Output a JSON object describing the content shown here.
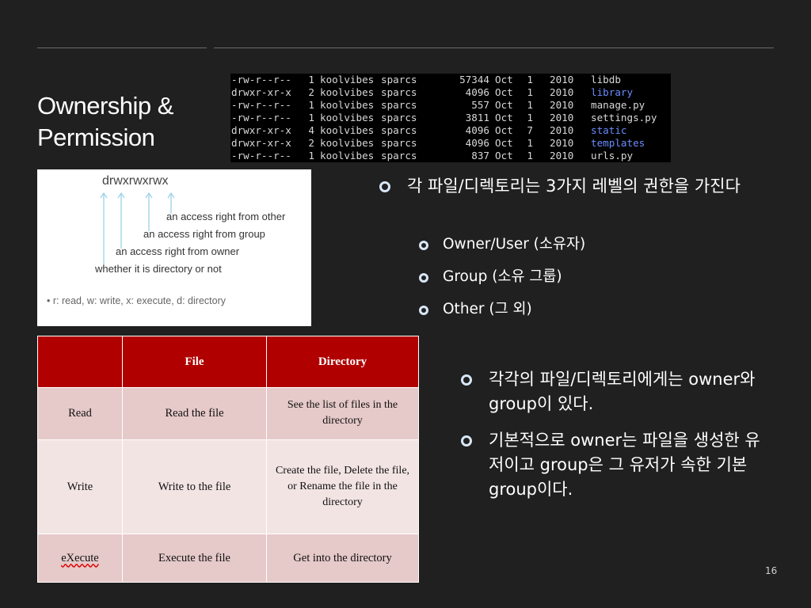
{
  "title": {
    "line1": "Ownership &",
    "line2": "Permission"
  },
  "terminal": {
    "rows": [
      {
        "perm": "-rw-r--r--",
        "links": "1",
        "owner": "koolvibes",
        "group": "sparcs",
        "size": "57344",
        "month": "Oct",
        "day": "1",
        "year": "2010",
        "name": "libdb",
        "is_dir": false
      },
      {
        "perm": "drwxr-xr-x",
        "links": "2",
        "owner": "koolvibes",
        "group": "sparcs",
        "size": "4096",
        "month": "Oct",
        "day": "1",
        "year": "2010",
        "name": "library",
        "is_dir": true
      },
      {
        "perm": "-rw-r--r--",
        "links": "1",
        "owner": "koolvibes",
        "group": "sparcs",
        "size": "557",
        "month": "Oct",
        "day": "1",
        "year": "2010",
        "name": "manage.py",
        "is_dir": false
      },
      {
        "perm": "-rw-r--r--",
        "links": "1",
        "owner": "koolvibes",
        "group": "sparcs",
        "size": "3811",
        "month": "Oct",
        "day": "1",
        "year": "2010",
        "name": "settings.py",
        "is_dir": false
      },
      {
        "perm": "drwxr-xr-x",
        "links": "4",
        "owner": "koolvibes",
        "group": "sparcs",
        "size": "4096",
        "month": "Oct",
        "day": "7",
        "year": "2010",
        "name": "static",
        "is_dir": true
      },
      {
        "perm": "drwxr-xr-x",
        "links": "2",
        "owner": "koolvibes",
        "group": "sparcs",
        "size": "4096",
        "month": "Oct",
        "day": "1",
        "year": "2010",
        "name": "templates",
        "is_dir": true
      },
      {
        "perm": "-rw-r--r--",
        "links": "1",
        "owner": "koolvibes",
        "group": "sparcs",
        "size": "837",
        "month": "Oct",
        "day": "1",
        "year": "2010",
        "name": "urls.py",
        "is_dir": false
      }
    ],
    "dir_color": "#6b8cff"
  },
  "diagram": {
    "perm_string": "drwxrwxrwx",
    "label_other": "an access right from other",
    "label_group": "an access right from group",
    "label_owner": "an access right from owner",
    "label_dir": "whether it is directory or not",
    "legend": "•  r: read, w: write, x: execute, d: directory"
  },
  "table": {
    "headers": [
      "",
      "File",
      "Directory"
    ],
    "rows": [
      {
        "label": "Read",
        "file": "Read the file",
        "dir": "See the list of files in the directory"
      },
      {
        "label": "Write",
        "file": "Write to the file",
        "dir": "Create the file, Delete the file, or Rename the file in the directory"
      },
      {
        "label": "eXecute",
        "file": "Execute the file",
        "dir": "Get into the directory"
      }
    ],
    "header_color": "#b00000"
  },
  "bullets": {
    "main": "각 파일/디렉토리는 3가지 레벨의 권한을 가진다",
    "sub": [
      "Owner/User (소유자)",
      "Group (소유 그룹)",
      "Other (그 외)"
    ],
    "second": "각각의 파일/디렉토리에게는 owner와 group이 있다.",
    "third": "기본적으로 owner는 파일을 생성한 유저이고 group은 그 유저가 속한 기본 group이다."
  },
  "page_number": "16"
}
